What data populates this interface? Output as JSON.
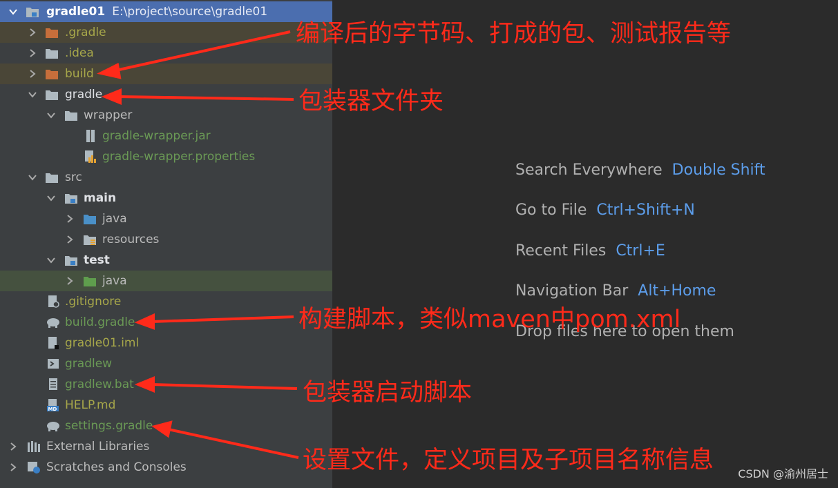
{
  "tree": {
    "root": {
      "name": "gradle01",
      "path": "E:\\project\\source\\gradle01"
    },
    "items": [
      {
        "label": ".gradle"
      },
      {
        "label": ".idea"
      },
      {
        "label": "build"
      },
      {
        "label": "gradle"
      },
      {
        "label": "wrapper"
      },
      {
        "label": "gradle-wrapper.jar"
      },
      {
        "label": "gradle-wrapper.properties"
      },
      {
        "label": "src"
      },
      {
        "label": "main"
      },
      {
        "label": "java"
      },
      {
        "label": "resources"
      },
      {
        "label": "test"
      },
      {
        "label": "java"
      },
      {
        "label": ".gitignore"
      },
      {
        "label": "build.gradle"
      },
      {
        "label": "gradle01.iml"
      },
      {
        "label": "gradlew"
      },
      {
        "label": "gradlew.bat"
      },
      {
        "label": "HELP.md"
      },
      {
        "label": "settings.gradle"
      },
      {
        "label": "External Libraries"
      },
      {
        "label": "Scratches and Consoles"
      }
    ]
  },
  "welcome": {
    "hints": [
      {
        "label": "Search Everywhere",
        "key": "Double Shift"
      },
      {
        "label": "Go to File",
        "key": "Ctrl+Shift+N"
      },
      {
        "label": "Recent Files",
        "key": "Ctrl+E"
      },
      {
        "label": "Navigation Bar",
        "key": "Alt+Home"
      }
    ],
    "drop_text": "Drop files here to open them"
  },
  "annotations": [
    "编译后的字节码、打成的包、测试报告等",
    "包装器文件夹",
    "构建脚本，类似maven中pom.xml",
    "包装器启动脚本",
    "设置文件，定义项目及子项目名称信息"
  ],
  "watermark": "CSDN @渝州居士",
  "colors": {
    "sidebar_bg": "#3c3f41",
    "editor_bg": "#2b2b2b",
    "selection": "#4b6eaf",
    "annotation": "#ff2a1a",
    "shortcut": "#5c9dea"
  }
}
